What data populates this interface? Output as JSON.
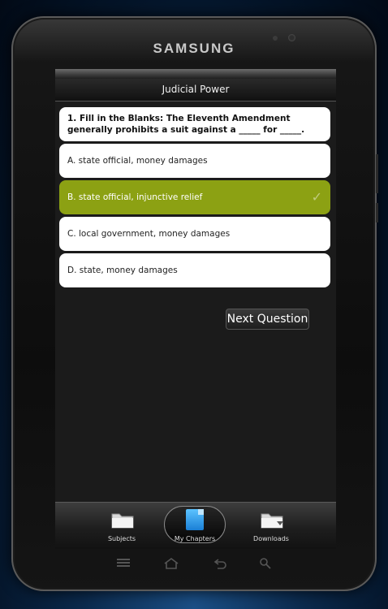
{
  "device": {
    "brand": "SAMSUNG"
  },
  "header": {
    "title": "Judicial Power"
  },
  "question": {
    "text": "1. Fill in the Blanks: The Eleventh Amendment generally prohibits a suit against a _____ for _____."
  },
  "answers": [
    {
      "label": "A. state official, money damages",
      "selected": false
    },
    {
      "label": "B. state official, injunctive relief",
      "selected": true
    },
    {
      "label": "C. local government, money damages",
      "selected": false
    },
    {
      "label": "D. state, money damages",
      "selected": false
    }
  ],
  "actions": {
    "next_label": "Next Question"
  },
  "tabs": [
    {
      "label": "Subjects",
      "icon": "folder-icon"
    },
    {
      "label": "My Chapters",
      "icon": "document-icon",
      "active": true
    },
    {
      "label": "Downloads",
      "icon": "folder-download-icon"
    }
  ],
  "colors": {
    "selected": "#8ca113",
    "background": "#1b1b1b"
  }
}
